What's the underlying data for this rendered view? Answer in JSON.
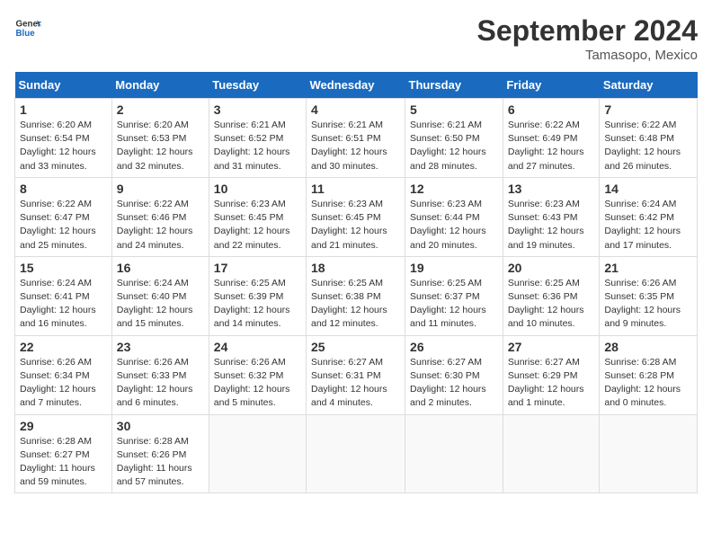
{
  "logo": {
    "line1": "General",
    "line2": "Blue"
  },
  "title": "September 2024",
  "location": "Tamasopo, Mexico",
  "days_header": [
    "Sunday",
    "Monday",
    "Tuesday",
    "Wednesday",
    "Thursday",
    "Friday",
    "Saturday"
  ],
  "weeks": [
    [
      {
        "day": "1",
        "sunrise": "6:20 AM",
        "sunset": "6:54 PM",
        "daylight": "12 hours and 33 minutes."
      },
      {
        "day": "2",
        "sunrise": "6:20 AM",
        "sunset": "6:53 PM",
        "daylight": "12 hours and 32 minutes."
      },
      {
        "day": "3",
        "sunrise": "6:21 AM",
        "sunset": "6:52 PM",
        "daylight": "12 hours and 31 minutes."
      },
      {
        "day": "4",
        "sunrise": "6:21 AM",
        "sunset": "6:51 PM",
        "daylight": "12 hours and 30 minutes."
      },
      {
        "day": "5",
        "sunrise": "6:21 AM",
        "sunset": "6:50 PM",
        "daylight": "12 hours and 28 minutes."
      },
      {
        "day": "6",
        "sunrise": "6:22 AM",
        "sunset": "6:49 PM",
        "daylight": "12 hours and 27 minutes."
      },
      {
        "day": "7",
        "sunrise": "6:22 AM",
        "sunset": "6:48 PM",
        "daylight": "12 hours and 26 minutes."
      }
    ],
    [
      {
        "day": "8",
        "sunrise": "6:22 AM",
        "sunset": "6:47 PM",
        "daylight": "12 hours and 25 minutes."
      },
      {
        "day": "9",
        "sunrise": "6:22 AM",
        "sunset": "6:46 PM",
        "daylight": "12 hours and 24 minutes."
      },
      {
        "day": "10",
        "sunrise": "6:23 AM",
        "sunset": "6:45 PM",
        "daylight": "12 hours and 22 minutes."
      },
      {
        "day": "11",
        "sunrise": "6:23 AM",
        "sunset": "6:45 PM",
        "daylight": "12 hours and 21 minutes."
      },
      {
        "day": "12",
        "sunrise": "6:23 AM",
        "sunset": "6:44 PM",
        "daylight": "12 hours and 20 minutes."
      },
      {
        "day": "13",
        "sunrise": "6:23 AM",
        "sunset": "6:43 PM",
        "daylight": "12 hours and 19 minutes."
      },
      {
        "day": "14",
        "sunrise": "6:24 AM",
        "sunset": "6:42 PM",
        "daylight": "12 hours and 17 minutes."
      }
    ],
    [
      {
        "day": "15",
        "sunrise": "6:24 AM",
        "sunset": "6:41 PM",
        "daylight": "12 hours and 16 minutes."
      },
      {
        "day": "16",
        "sunrise": "6:24 AM",
        "sunset": "6:40 PM",
        "daylight": "12 hours and 15 minutes."
      },
      {
        "day": "17",
        "sunrise": "6:25 AM",
        "sunset": "6:39 PM",
        "daylight": "12 hours and 14 minutes."
      },
      {
        "day": "18",
        "sunrise": "6:25 AM",
        "sunset": "6:38 PM",
        "daylight": "12 hours and 12 minutes."
      },
      {
        "day": "19",
        "sunrise": "6:25 AM",
        "sunset": "6:37 PM",
        "daylight": "12 hours and 11 minutes."
      },
      {
        "day": "20",
        "sunrise": "6:25 AM",
        "sunset": "6:36 PM",
        "daylight": "12 hours and 10 minutes."
      },
      {
        "day": "21",
        "sunrise": "6:26 AM",
        "sunset": "6:35 PM",
        "daylight": "12 hours and 9 minutes."
      }
    ],
    [
      {
        "day": "22",
        "sunrise": "6:26 AM",
        "sunset": "6:34 PM",
        "daylight": "12 hours and 7 minutes."
      },
      {
        "day": "23",
        "sunrise": "6:26 AM",
        "sunset": "6:33 PM",
        "daylight": "12 hours and 6 minutes."
      },
      {
        "day": "24",
        "sunrise": "6:26 AM",
        "sunset": "6:32 PM",
        "daylight": "12 hours and 5 minutes."
      },
      {
        "day": "25",
        "sunrise": "6:27 AM",
        "sunset": "6:31 PM",
        "daylight": "12 hours and 4 minutes."
      },
      {
        "day": "26",
        "sunrise": "6:27 AM",
        "sunset": "6:30 PM",
        "daylight": "12 hours and 2 minutes."
      },
      {
        "day": "27",
        "sunrise": "6:27 AM",
        "sunset": "6:29 PM",
        "daylight": "12 hours and 1 minute."
      },
      {
        "day": "28",
        "sunrise": "6:28 AM",
        "sunset": "6:28 PM",
        "daylight": "12 hours and 0 minutes."
      }
    ],
    [
      {
        "day": "29",
        "sunrise": "6:28 AM",
        "sunset": "6:27 PM",
        "daylight": "11 hours and 59 minutes."
      },
      {
        "day": "30",
        "sunrise": "6:28 AM",
        "sunset": "6:26 PM",
        "daylight": "11 hours and 57 minutes."
      },
      null,
      null,
      null,
      null,
      null
    ]
  ]
}
